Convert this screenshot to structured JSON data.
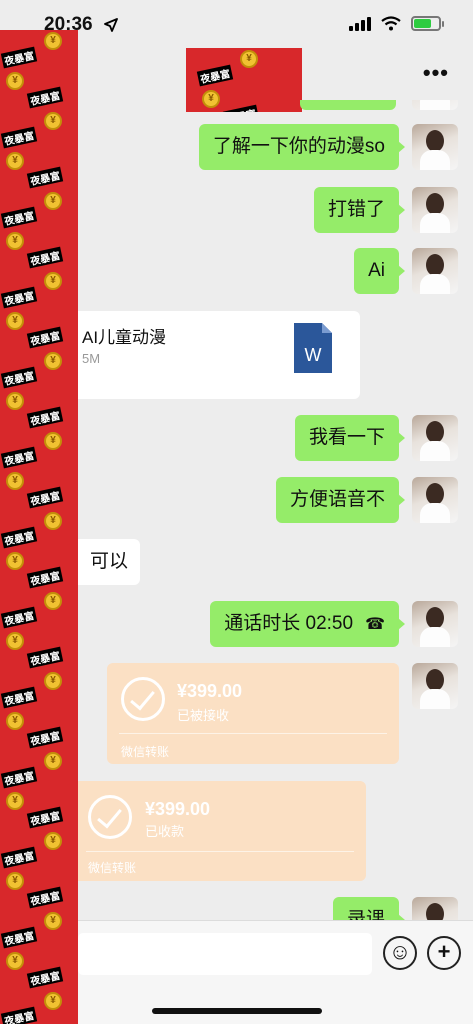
{
  "status_bar": {
    "time": "20:36",
    "location_icon": "location-arrow-icon",
    "signal_icon": "cellular-signal-icon",
    "wifi_icon": "wifi-icon",
    "battery_icon": "battery-charging-icon",
    "battery_color": "#2ecc40"
  },
  "header": {
    "more_label": "•••"
  },
  "sticker": {
    "caption": "夜暴富",
    "coin_symbol": "¥",
    "color": "#d8282b"
  },
  "messages": [
    {
      "id": "m1",
      "type": "text",
      "side": "right",
      "text": "了解一下你的动漫so"
    },
    {
      "id": "m2",
      "type": "text",
      "side": "right",
      "text": "打错了"
    },
    {
      "id": "m3",
      "type": "text",
      "side": "right",
      "text": "Ai"
    },
    {
      "id": "m4",
      "type": "file",
      "side": "left",
      "name": "AI儿童动漫",
      "size": "5M",
      "icon": "word-file-icon"
    },
    {
      "id": "m5",
      "type": "text",
      "side": "right",
      "text": "我看一下"
    },
    {
      "id": "m6",
      "type": "text",
      "side": "right",
      "text": "方便语音不"
    },
    {
      "id": "m7",
      "type": "text",
      "side": "left",
      "text": "可以"
    },
    {
      "id": "m8",
      "type": "call",
      "side": "right",
      "text": "通话时长 02:50",
      "icon": "phone-hangup-icon"
    },
    {
      "id": "m9",
      "type": "transfer",
      "side": "right",
      "amount": "¥399.00",
      "status": "已被接收",
      "footer": "微信转账"
    },
    {
      "id": "m10",
      "type": "transfer",
      "side": "left",
      "amount": "¥399.00",
      "status": "已收款",
      "footer": "微信转账"
    },
    {
      "id": "m11",
      "type": "text",
      "side": "right",
      "text": "录课"
    }
  ],
  "input_bar": {
    "emoji_icon": "emoji-smile-icon",
    "plus_icon": "plus-circle-icon",
    "emoji_label": "☺",
    "plus_label": "+"
  },
  "colors": {
    "bubble_green": "#95ec69",
    "transfer_bg": "#fbe0c4",
    "chat_bg": "#ededed",
    "word_blue": "#2b579a"
  }
}
